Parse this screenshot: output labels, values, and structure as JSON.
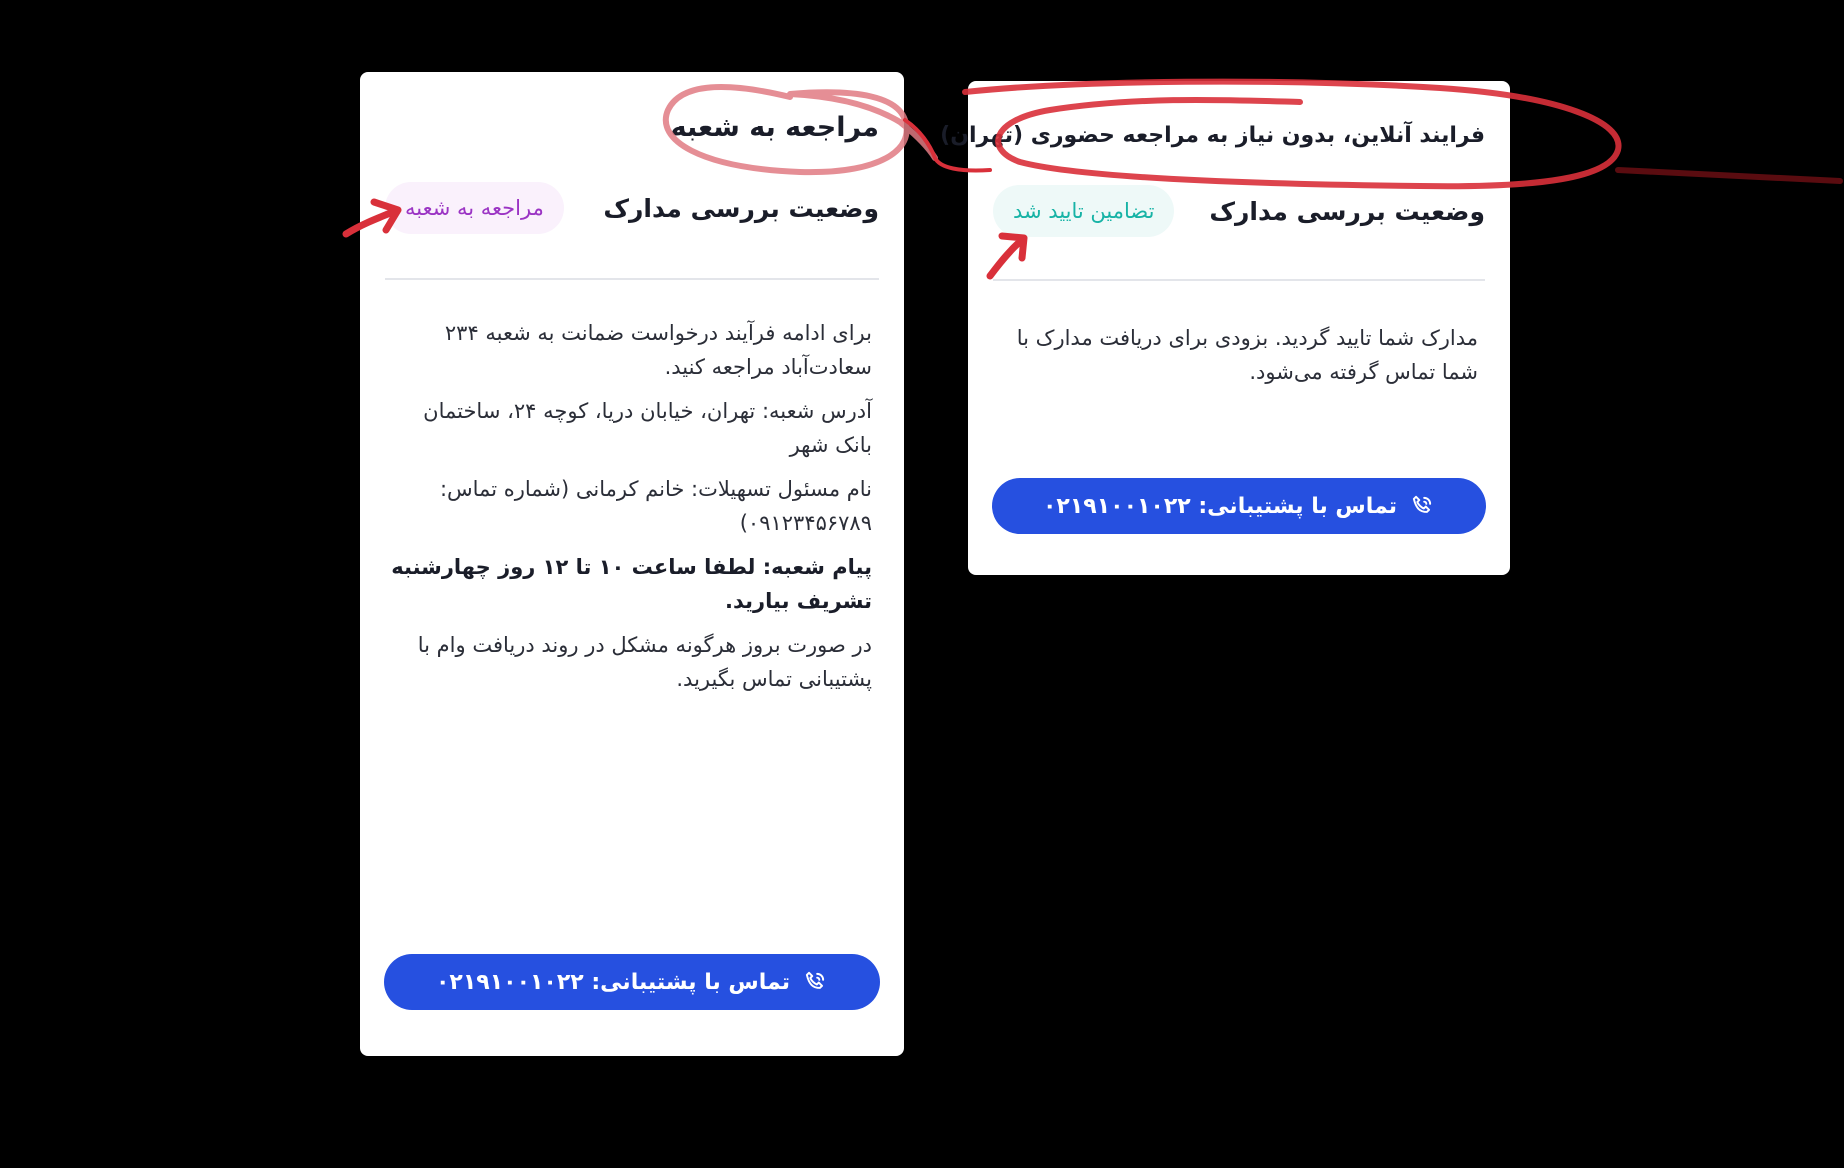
{
  "left_card": {
    "title": "مراجعه به شعبه",
    "status_label": "وضعیت بررسی مدارک",
    "status_badge": "مراجعه به شعبه",
    "paragraphs": [
      "برای ادامه فرآیند درخواست ضمانت به شعبه ۲۳۴ سعادت‌آباد مراجعه کنید.",
      "آدرس شعبه: تهران، خیابان دریا، کوچه ۲۴، ساختمان بانک شهر",
      "نام مسئول تسهیلات: خانم کرمانی (شماره تماس: ۰۹۱۲۳۴۵۶۷۸۹)",
      "پیام شعبه: لطفا ساعت ۱۰ تا ۱۲ روز چهارشنبه تشریف بیارید.",
      "در صورت بروز هرگونه مشکل در روند دریافت وام با پشتیبانی تماس بگیرید."
    ],
    "support_button": "تماس با پشتیبانی: ۰۲۱۹۱۰۰۱۰۲۲"
  },
  "right_card": {
    "title": "فرایند آنلاین، بدون نیاز به مراجعه حضوری (تهران)",
    "status_label": "وضعیت بررسی مدارک",
    "status_badge": "تضامین تایید شد",
    "paragraphs": [
      "مدارک شما تایید گردید. بزودی برای دریافت مدارک با شما تماس گرفته می‌شود."
    ],
    "support_button": "تماس با پشتیبانی: ۰۲۱۹۱۰۰۱۰۲۲"
  },
  "colors": {
    "background": "#000000",
    "card": "#ffffff",
    "button": "#2650e0",
    "badge_purple_text": "#9b34c4",
    "badge_purple_bg": "#faf1fc",
    "badge_teal_text": "#17b3a6",
    "badge_teal_bg": "#eef9f8",
    "annotation_red": "#d9303a"
  },
  "icons": {
    "support_button": "phone-icon",
    "annotation": "red-circle-and-arrow"
  }
}
